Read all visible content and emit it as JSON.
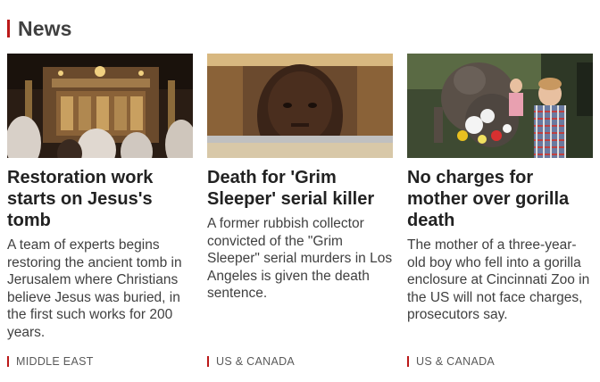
{
  "section": {
    "title": "News"
  },
  "stories": [
    {
      "image_alt": "Interior of the Church of the Holy Sepulchre with worshippers",
      "headline": "Restoration work starts on Jesus's tomb",
      "summary": "A team of experts begins restoring the ancient tomb in Jerusalem where Christians believe Jesus was buried, in the first such works for 200 years.",
      "tag": "MIDDLE EAST"
    },
    {
      "image_alt": "Man in court behind a rail",
      "headline": "Death for 'Grim Sleeper' serial killer",
      "summary": "A former rubbish collector convicted of the \"Grim Sleeper\" serial murders in Los Angeles is given the death sentence.",
      "tag": "US & CANADA"
    },
    {
      "image_alt": "Child beside gorilla statue with flowers",
      "headline": "No charges for mother over gorilla death",
      "summary": "The mother of a three-year-old boy who fell into a gorilla enclosure at Cincinnati Zoo in the US will not face charges, prosecutors say.",
      "tag": "US & CANADA"
    }
  ],
  "colors": {
    "accent": "#bb1919",
    "headline": "#222222",
    "body": "#404040",
    "tag": "#5a5a5a"
  }
}
